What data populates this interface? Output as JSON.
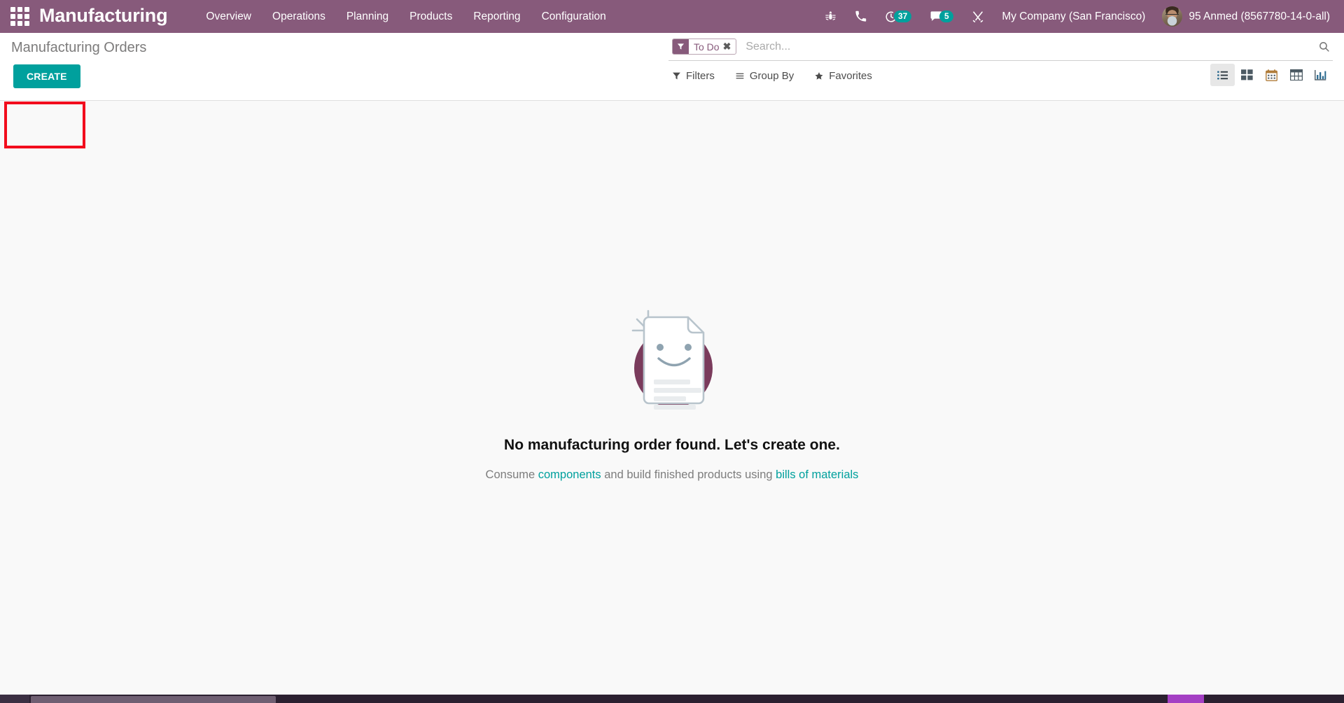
{
  "theme": {
    "brand_purple": "#875A7B",
    "accent_teal": "#00A09D",
    "annotation_red": "#f20d1d",
    "content_bg": "#f9f9f9"
  },
  "navbar": {
    "apps_icon": "apps-grid-icon",
    "brand": "Manufacturing",
    "menu": [
      {
        "label": "Overview"
      },
      {
        "label": "Operations"
      },
      {
        "label": "Planning"
      },
      {
        "label": "Products"
      },
      {
        "label": "Reporting"
      },
      {
        "label": "Configuration"
      }
    ],
    "sys_icons": [
      {
        "name": "bug-icon",
        "badge": null
      },
      {
        "name": "phone-icon",
        "badge": null
      },
      {
        "name": "clock-activities-icon",
        "badge": "37"
      },
      {
        "name": "messages-icon",
        "badge": "5"
      },
      {
        "name": "tools-icon",
        "badge": null
      }
    ],
    "company": "My Company (San Francisco)",
    "user": "95 Anmed (8567780-14-0-all)",
    "avatar_icon": "user-avatar"
  },
  "control_panel": {
    "title": "Manufacturing Orders",
    "create_label": "CREATE",
    "search": {
      "facet_icon": "filter-funnel-icon",
      "facet_label": "To Do",
      "facet_remove": "✖",
      "placeholder": "Search...",
      "value": "",
      "magnifier_icon": "search-icon"
    },
    "buttons": [
      {
        "label": "Filters",
        "icon": "funnel-icon"
      },
      {
        "label": "Group By",
        "icon": "hamburger-icon"
      },
      {
        "label": "Favorites",
        "icon": "star-icon"
      }
    ],
    "views": [
      {
        "name": "list-view",
        "icon": "list-icon",
        "active": true
      },
      {
        "name": "kanban-view",
        "icon": "kanban-icon",
        "active": false
      },
      {
        "name": "calendar-view",
        "icon": "calendar-icon",
        "active": false
      },
      {
        "name": "pivot-view",
        "icon": "pivot-table-icon",
        "active": false
      },
      {
        "name": "graph-view",
        "icon": "bar-chart-icon",
        "active": false
      }
    ]
  },
  "empty_state": {
    "illustration": "smiling-document-icon",
    "title": "No manufacturing order found. Let's create one.",
    "sub_before": "Consume ",
    "link1": "components",
    "sub_middle": " and build finished products using ",
    "link2": "bills of materials"
  }
}
